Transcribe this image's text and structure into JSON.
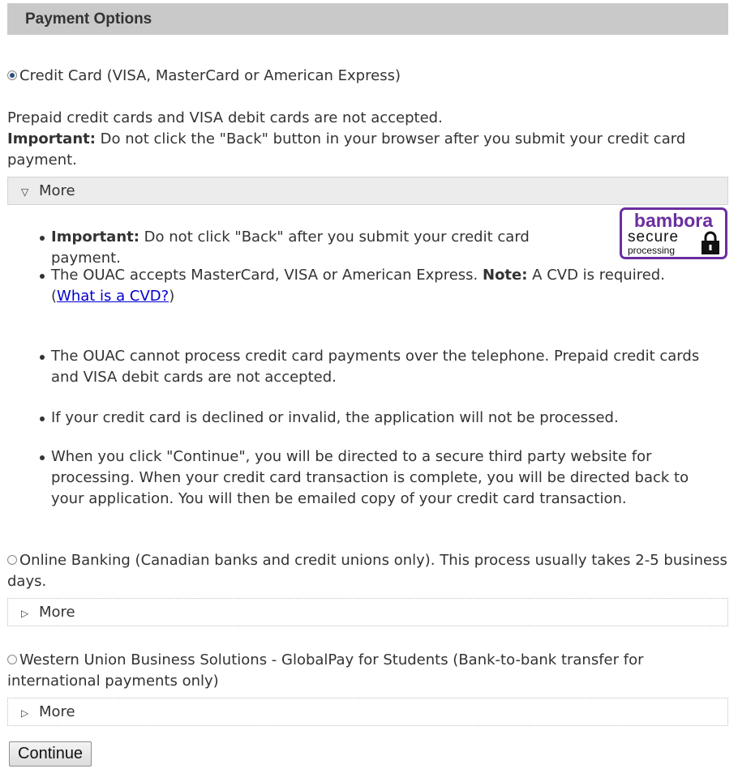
{
  "header": {
    "title": "Payment Options"
  },
  "credit_card": {
    "label": "Credit Card (VISA, MasterCard or American Express)",
    "selected": true,
    "note_line": "Prepaid credit cards and VISA debit cards are not accepted.",
    "important_label": "Important:",
    "important_text": " Do not click the \"Back\" button in your browser after you submit your credit card payment.",
    "more_label": "More",
    "details": {
      "item1_label": "Important:",
      "item1_text": " Do not click \"Back\" after you submit your credit card payment.",
      "item2_text_a": "The OUAC accepts MasterCard, VISA or American Express. ",
      "item2_note_label": "Note:",
      "item2_text_b": " A CVD is required.",
      "item2_paren_open": "(",
      "item2_link": "What is a CVD?",
      "item2_paren_close": ")",
      "item3_text": "The OUAC cannot process credit card payments over the telephone. Prepaid credit cards and VISA debit cards are not accepted.",
      "item4_text": "If your credit card is declined or invalid, the application will not be processed.",
      "item5_text": "When you click \"Continue\", you will be directed to a secure third party website for processing. When your credit card transaction is complete, you will be directed back to your application. You will then be emailed copy of your credit card transaction."
    },
    "badge": {
      "brand": "bambora",
      "line1": "secure",
      "line2": "processing"
    }
  },
  "online_banking": {
    "label": "Online Banking (Canadian banks and credit unions only). This process usually takes 2-5 business days.",
    "selected": false,
    "more_label": "More"
  },
  "western_union": {
    "label": "Western Union Business Solutions - GlobalPay for Students (Bank-to-bank transfer for international payments only)",
    "selected": false,
    "more_label": "More"
  },
  "continue_label": "Continue"
}
